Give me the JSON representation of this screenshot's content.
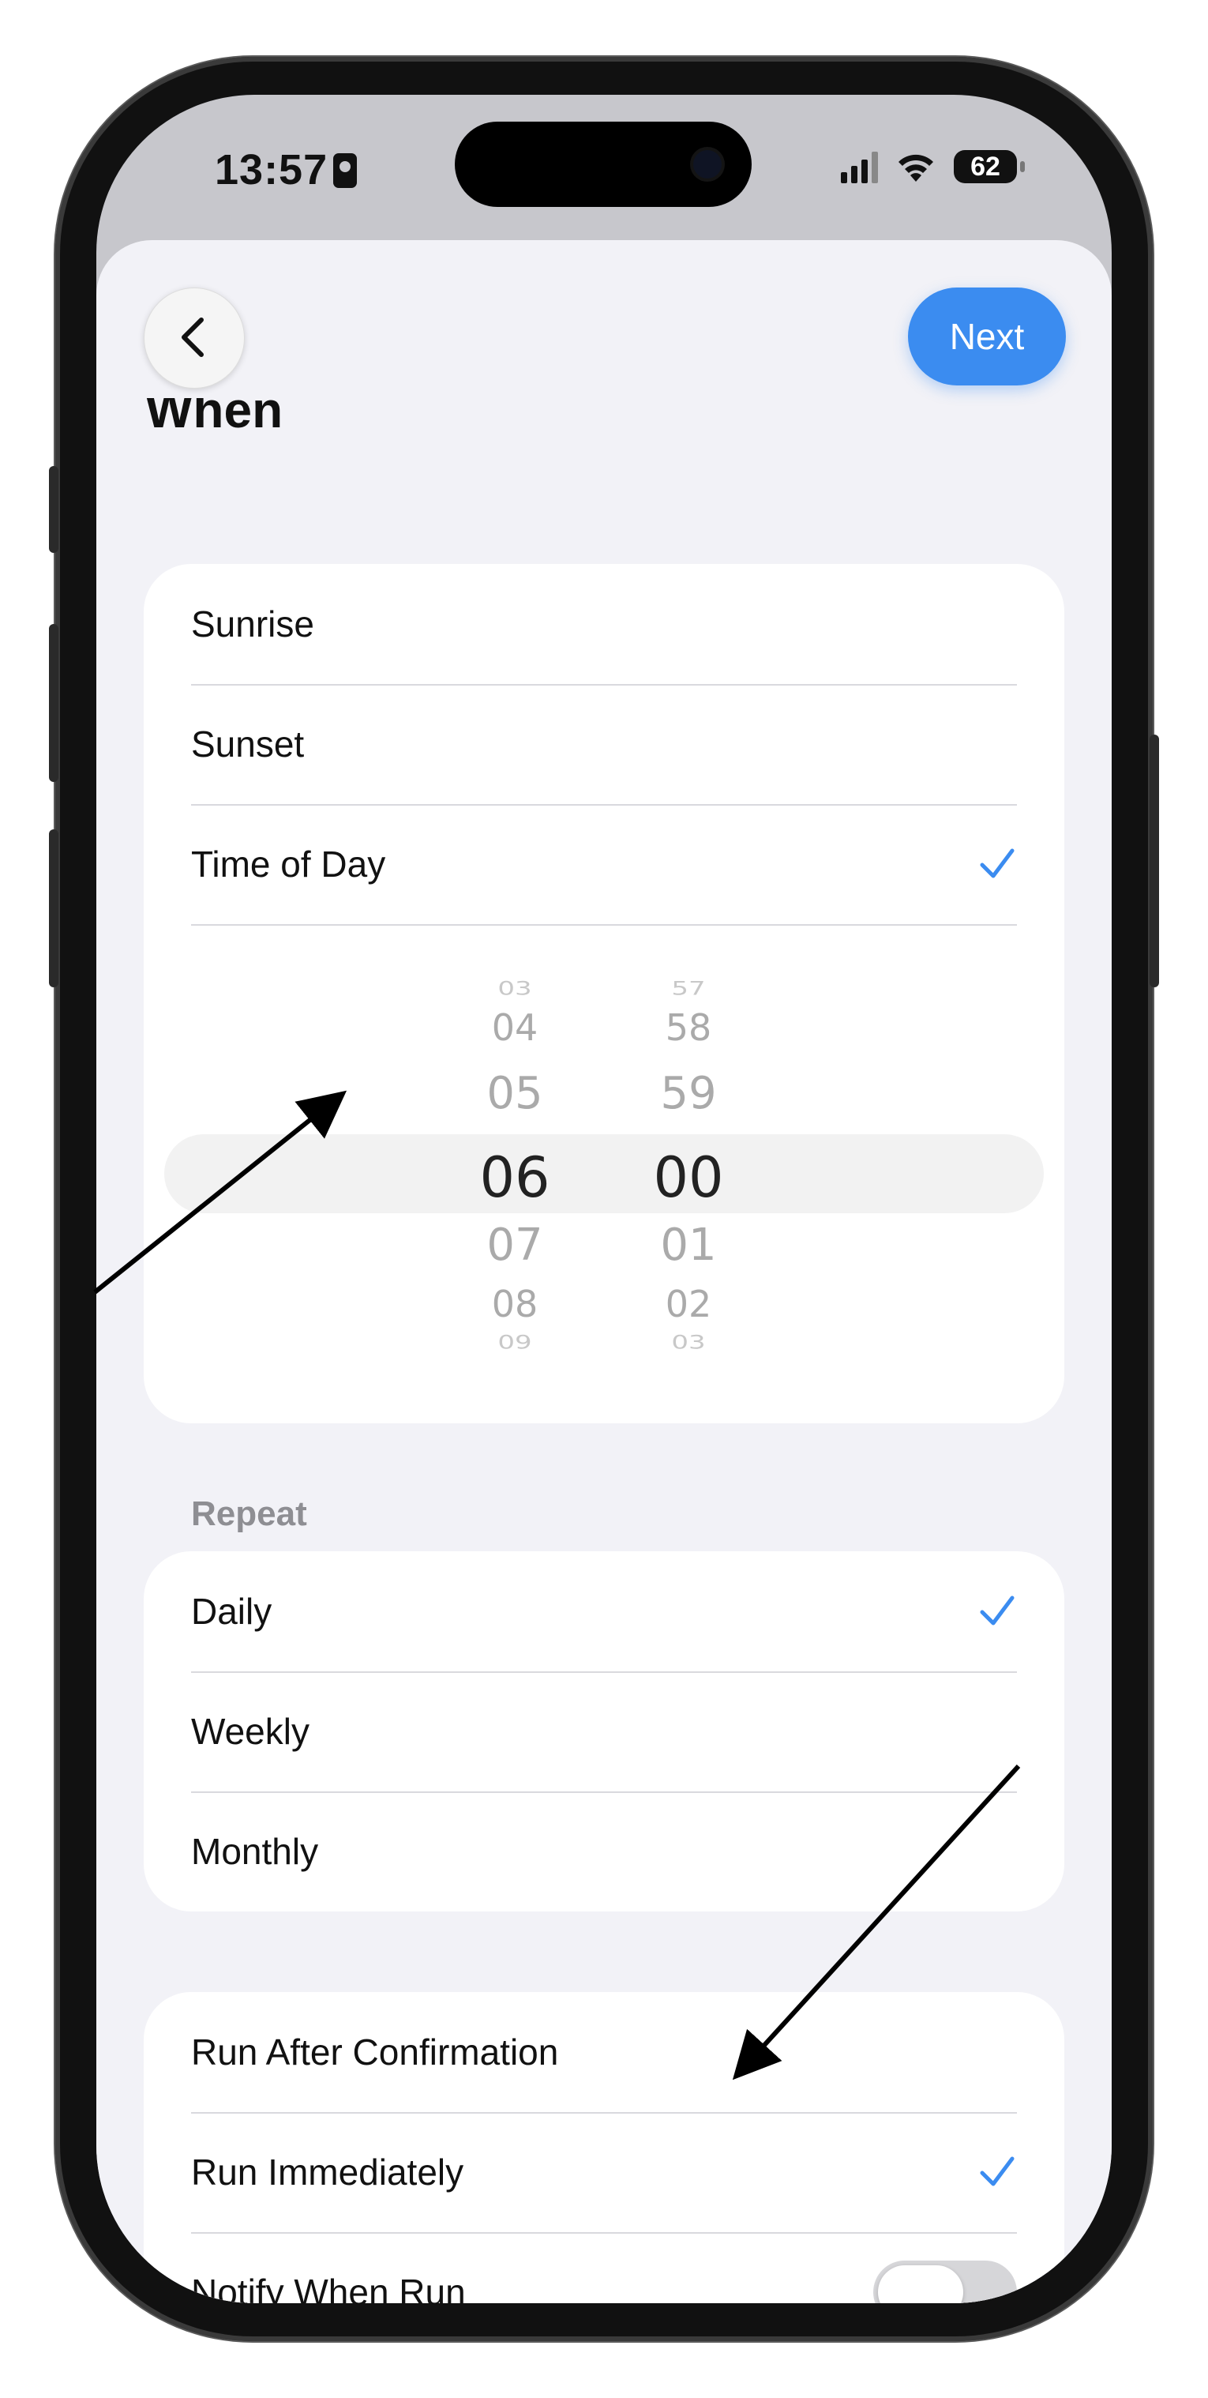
{
  "status": {
    "time": "13:57",
    "battery": "62"
  },
  "header": {
    "next_label": "Next",
    "section_title": "When"
  },
  "when_options": [
    {
      "label": "Sunrise",
      "checked": false
    },
    {
      "label": "Sunset",
      "checked": false
    },
    {
      "label": "Time of Day",
      "checked": true
    }
  ],
  "picker": {
    "hours": [
      "03",
      "04",
      "05",
      "06",
      "07",
      "08",
      "09"
    ],
    "minutes": [
      "57",
      "58",
      "59",
      "00",
      "01",
      "02",
      "03"
    ],
    "selected_hour": "06",
    "selected_minute": "00"
  },
  "repeat": {
    "label": "Repeat",
    "options": [
      {
        "label": "Daily",
        "checked": true
      },
      {
        "label": "Weekly",
        "checked": false
      },
      {
        "label": "Monthly",
        "checked": false
      }
    ]
  },
  "run": {
    "options": [
      {
        "label": "Run After Confirmation",
        "checked": false
      },
      {
        "label": "Run Immediately",
        "checked": true
      }
    ],
    "notify_label": "Notify When Run",
    "notify_on": false
  },
  "colors": {
    "accent": "#3b8cf0",
    "sheet_bg": "#f2f2f7",
    "card_bg": "#ffffff"
  }
}
